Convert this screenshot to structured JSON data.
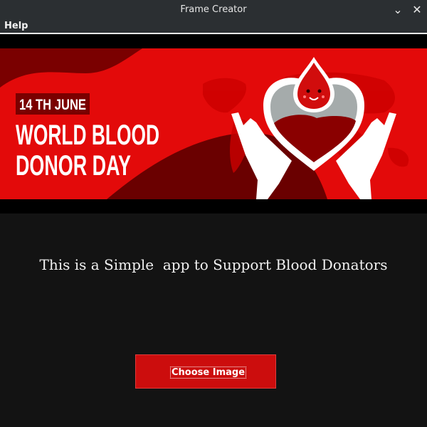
{
  "window": {
    "title": "Frame Creator",
    "minimize_glyph": "⌄",
    "close_glyph": "✕"
  },
  "menubar": {
    "help_label": "Help"
  },
  "banner": {
    "date_label": "14 TH JUNE",
    "headline_line1": "WORLD BLOOD",
    "headline_line2": "DONOR DAY",
    "colors": {
      "background": "#e30a0a",
      "dark_red": "#7a0000",
      "deep_red": "#a80000",
      "white": "#ffffff",
      "heart_grey": "#a5abab"
    },
    "icons": [
      "blood-drop-mascot-icon",
      "heart-icon",
      "hands-icon",
      "world-map-icon"
    ]
  },
  "main": {
    "tagline": "This is a Simple  app to Support Blood Donators"
  },
  "actions": {
    "choose_image_label": "Choose Image"
  }
}
